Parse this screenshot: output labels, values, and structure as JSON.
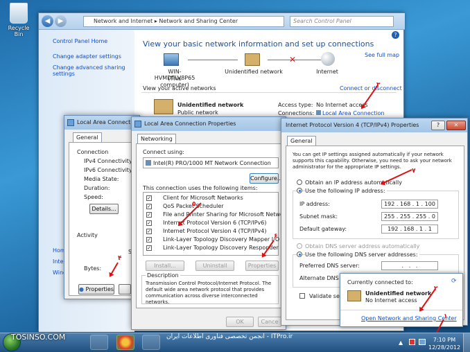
{
  "desktop": {
    "recycle_bin": "Recycle Bin"
  },
  "explorer": {
    "address": [
      "Network and Internet",
      "Network and Sharing Center"
    ],
    "search_placeholder": "Search Control Panel",
    "sidebar": [
      "Control Panel Home",
      "Change adapter settings",
      "Change advanced sharing settings",
      "Home",
      "Inter",
      "Wind"
    ],
    "heading": "View your basic network information and set up connections",
    "see_full_map": "See full map",
    "map": {
      "computer": "WIN-HVMDTLV8P65",
      "computer_sub": "(This computer)",
      "network": "Unidentified network",
      "internet": "Internet"
    },
    "active_networks": "View your active networks",
    "connect_disconnect": "Connect or disconnect",
    "net_name": "Unidentified network",
    "net_type": "Public network",
    "access_type_label": "Access type:",
    "access_type_value": "No Internet access",
    "connections_label": "Connections:",
    "connections_value": "Local Area Connection"
  },
  "status_dialog": {
    "title": "Local Area Connection",
    "tab": "General",
    "group": "Connection",
    "rows": [
      "IPv4 Connectivity:",
      "IPv6 Connectivity:",
      "Media State:",
      "Duration:",
      "Speed:"
    ],
    "details_btn": "Details...",
    "activity": "Activity",
    "sent": "S",
    "bytes": "Bytes:",
    "properties_btn": "Properties"
  },
  "props_dialog": {
    "title": "Local Area Connection Properties",
    "tab": "Networking",
    "connect_using": "Connect using:",
    "adapter": "Intel(R) PRO/1000 MT Network Connection",
    "configure_btn": "Configure...",
    "items_label": "This connection uses the following items:",
    "items": [
      "Client for Microsoft Networks",
      "QoS Packet Scheduler",
      "File and Printer Sharing for Microsoft Networks",
      "Internet Protocol Version 6 (TCP/IPv6)",
      "Internet Protocol Version 4 (TCP/IPv4)",
      "Link-Layer Topology Discovery Mapper I/O Driver",
      "Link-Layer Topology Discovery Responder"
    ],
    "install_btn": "Install...",
    "uninstall_btn": "Uninstall",
    "properties_btn": "Properties",
    "description_label": "Description",
    "description": "Transmission Control Protocol/Internet Protocol. The default wide area network protocol that provides communication across diverse interconnected networks.",
    "ok_btn": "OK",
    "cancel_btn": "Cance"
  },
  "ipv4_dialog": {
    "title": "Internet Protocol Version 4 (TCP/IPv4) Properties",
    "help": "?",
    "close": "✕",
    "tab": "General",
    "intro": "You can get IP settings assigned automatically if your network supports this capability. Otherwise, you need to ask your network administrator for the appropriate IP settings.",
    "auto_ip": "Obtain an IP address automatically",
    "manual_ip": "Use the following IP address:",
    "ip_label": "IP address:",
    "ip": [
      "192",
      "168",
      "1",
      "100"
    ],
    "mask_label": "Subnet mask:",
    "mask": [
      "255",
      "255",
      "255",
      "0"
    ],
    "gw_label": "Default gateway:",
    "gw": [
      "192",
      "168",
      "1",
      "1"
    ],
    "auto_dns": "Obtain DNS server address automatically",
    "manual_dns": "Use the following DNS server addresses:",
    "pref_dns": "Preferred DNS server:",
    "alt_dns": "Alternate DNS serv",
    "validate": "Validate setti"
  },
  "popup": {
    "header": "Currently connected to:",
    "net": "Unidentified network",
    "status": "No Internet access",
    "link": "Open Network and Sharing Center"
  },
  "taskbar": {
    "watermark": "TOSINSO.COM",
    "watermark2": "انجمن تخصصی فناوری اطلاعات ایران - ITPro.ir",
    "time": "7:10 PM",
    "date": "12/28/2012"
  },
  "annotations": [
    "۱",
    "۲",
    "۳",
    "۴",
    "۵",
    "۶",
    "۷"
  ],
  "colors": {
    "link": "#0f4ecc",
    "arrow": "#e01010",
    "title": "#1e4f9c"
  }
}
